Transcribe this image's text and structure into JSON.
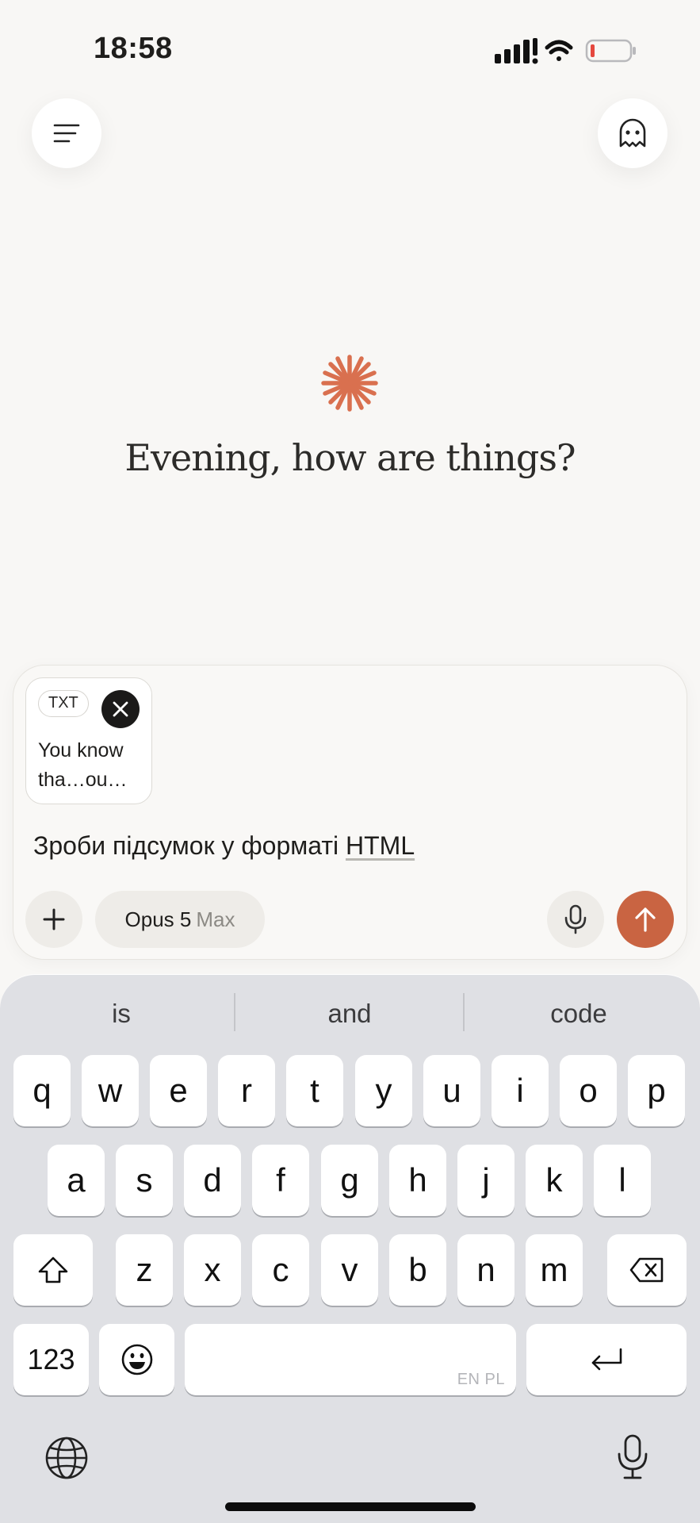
{
  "status_bar": {
    "time": "18:58"
  },
  "header": {
    "menu_icon": "menu-icon",
    "ghost_icon": "ghost-icon"
  },
  "greeting": {
    "text": "Evening, how are things?"
  },
  "composer": {
    "attachment": {
      "tag": "TXT",
      "preview_line1": "You know",
      "preview_line2": "tha…ou…"
    },
    "input_text_pre": "Зроби підсумок у форматі ",
    "input_text_underlined": "HTML",
    "model_name": "Opus 5",
    "model_mode": "Max",
    "accent_color": "#c96442"
  },
  "keyboard": {
    "suggestions": [
      "is",
      "and",
      "code"
    ],
    "row1": [
      "q",
      "w",
      "e",
      "r",
      "t",
      "y",
      "u",
      "i",
      "o",
      "p"
    ],
    "row2": [
      "a",
      "s",
      "d",
      "f",
      "g",
      "h",
      "j",
      "k",
      "l"
    ],
    "row3": [
      "z",
      "x",
      "c",
      "v",
      "b",
      "n",
      "m"
    ],
    "numbers_key": "123",
    "space_hint": "EN PL"
  }
}
